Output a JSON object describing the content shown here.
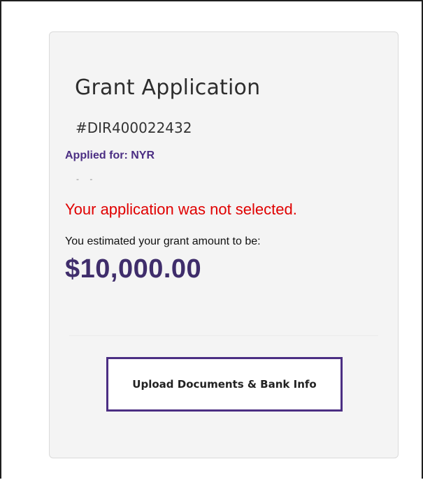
{
  "card": {
    "title": "Grant Application",
    "application_number": "#DIR400022432",
    "applied_for": "Applied for: NYR",
    "ellipsis": "- -",
    "status_message": "Your application was not selected.",
    "estimate_label": "You estimated your grant amount to be:",
    "grant_amount": "$10,000.00",
    "upload_button_label": "Upload Documents & Bank Info"
  },
  "colors": {
    "accent_purple": "#4b2e83",
    "amount_purple": "#3f2d6b",
    "status_red": "#e00000",
    "card_background": "#f4f4f4"
  }
}
